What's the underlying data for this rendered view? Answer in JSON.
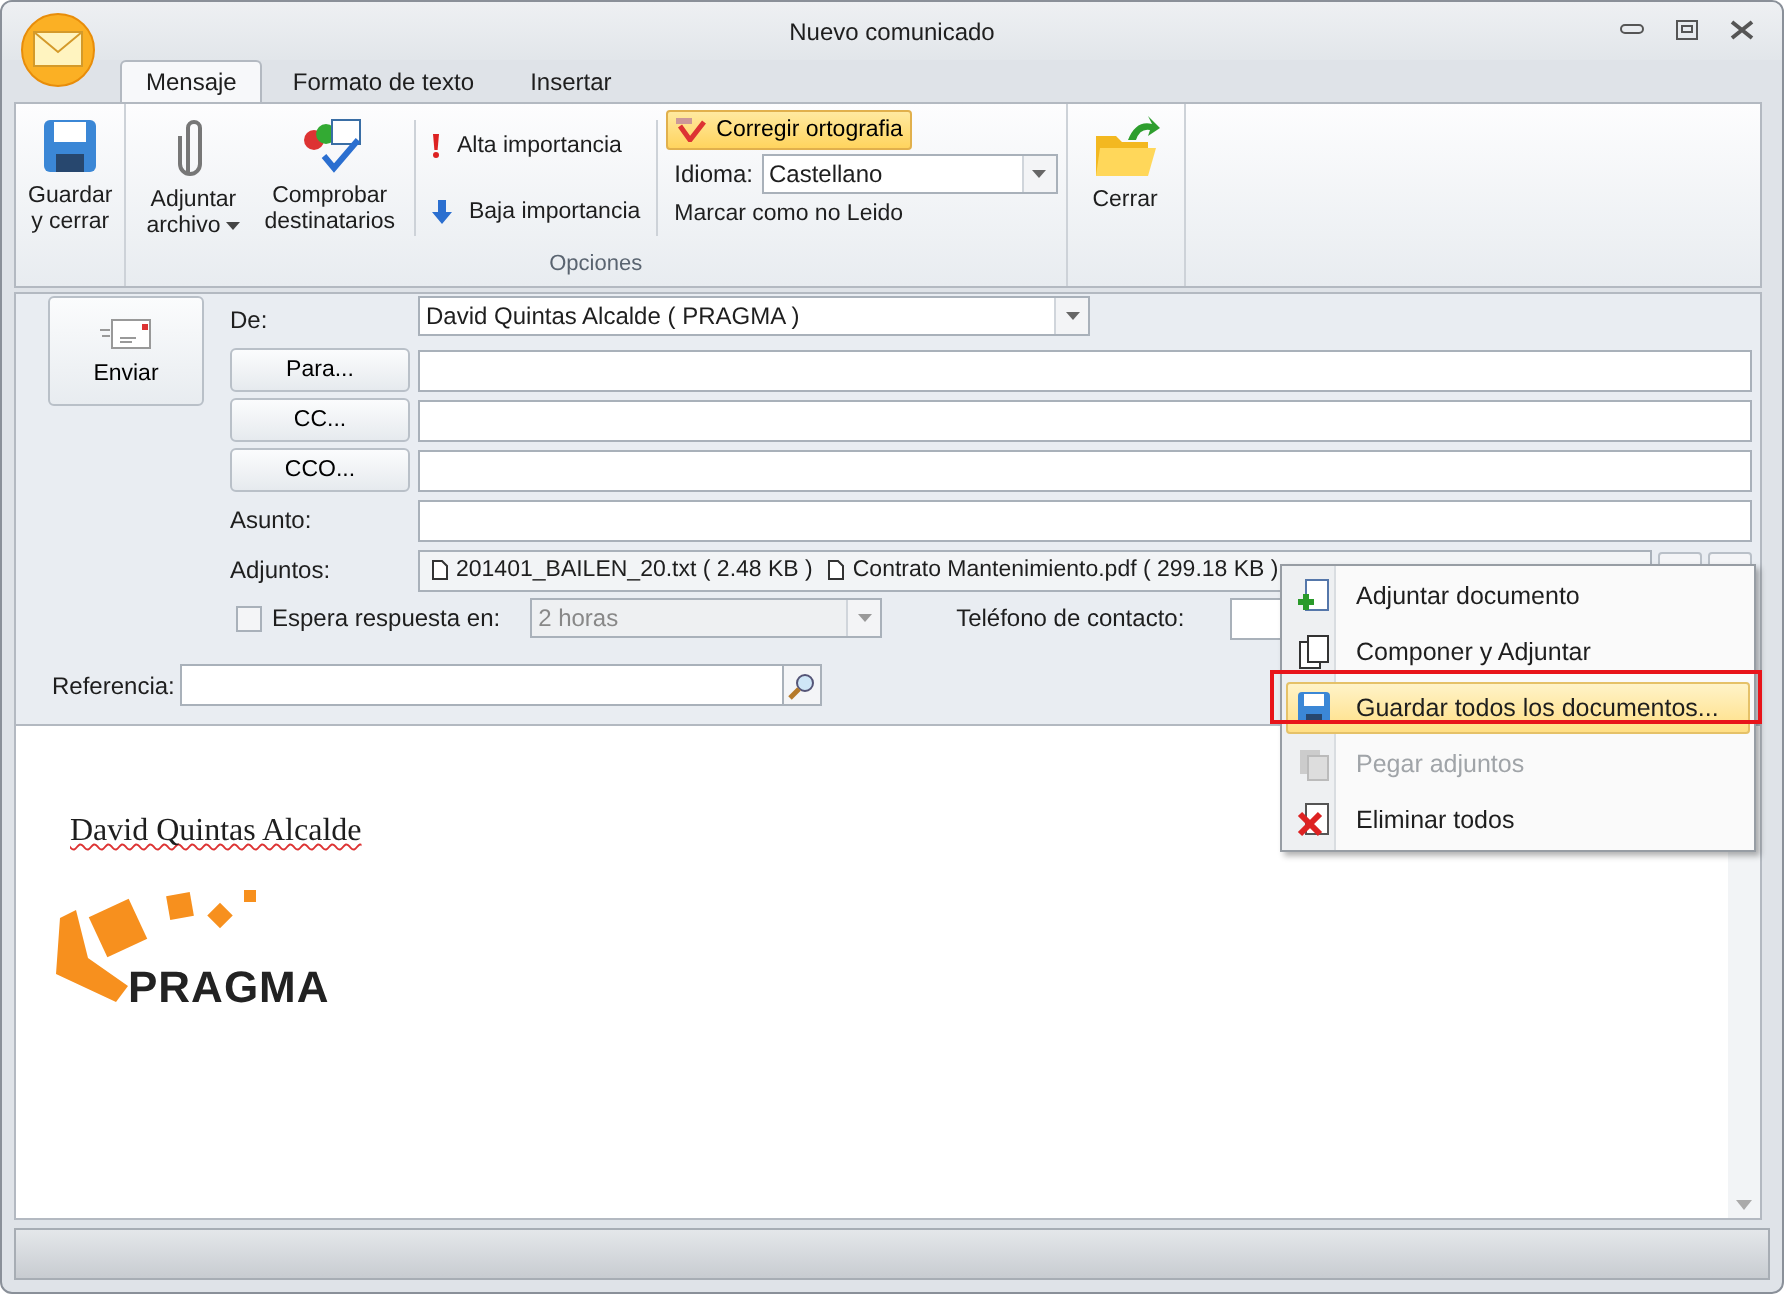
{
  "window": {
    "title": "Nuevo comunicado"
  },
  "tabs": [
    {
      "label": "Mensaje",
      "selected": true
    },
    {
      "label": "Formato de texto",
      "selected": false
    },
    {
      "label": "Insertar",
      "selected": false
    }
  ],
  "ribbon": {
    "save": "Guardar\ny cerrar",
    "attach": "Adjuntar\narchivo",
    "check": "Comprobar\ndestinatarios",
    "high": "Alta importancia",
    "low": "Baja importancia",
    "spell": {
      "label": "Corregir ortografia",
      "on": true
    },
    "language": {
      "label": "Idioma:",
      "value": "Castellano"
    },
    "mark_unread": "Marcar como no Leido",
    "group_label": "Opciones",
    "close": "Cerrar"
  },
  "form": {
    "send": "Enviar",
    "from": {
      "label": "De:",
      "value": "David Quintas Alcalde ( PRAGMA )"
    },
    "recipients": [
      {
        "button": "Para..."
      },
      {
        "button": "CC..."
      },
      {
        "button": "CCO..."
      }
    ],
    "subject": {
      "label": "Asunto:"
    },
    "attachments": {
      "label": "Adjuntos:",
      "files": [
        "201401_BAILEN_20.txt ( 2.48 KB )",
        "Contrato Mantenimiento.pdf ( 299.18 KB )"
      ]
    },
    "wait_reply": {
      "label": "Espera respuesta en:",
      "checked": false,
      "value": "2 horas",
      "disabled": true
    },
    "phone": {
      "label": "Teléfono de contacto:"
    },
    "reference": {
      "label": "Referencia:"
    }
  },
  "body": {
    "signature": "David Quintas Alcalde",
    "logo": "PRAGMA"
  },
  "context_menu": [
    {
      "label": "Adjuntar documento",
      "kind": "add",
      "disabled": false,
      "selected": false
    },
    {
      "label": "Componer y Adjuntar",
      "kind": "compose",
      "disabled": false,
      "selected": false
    },
    {
      "label": "Guardar todos los documentos...",
      "kind": "save",
      "disabled": false,
      "selected": true
    },
    {
      "label": "Pegar adjuntos",
      "kind": "paste",
      "disabled": true,
      "selected": false
    },
    {
      "label": "Eliminar todos",
      "kind": "delete",
      "disabled": false,
      "selected": false
    }
  ]
}
